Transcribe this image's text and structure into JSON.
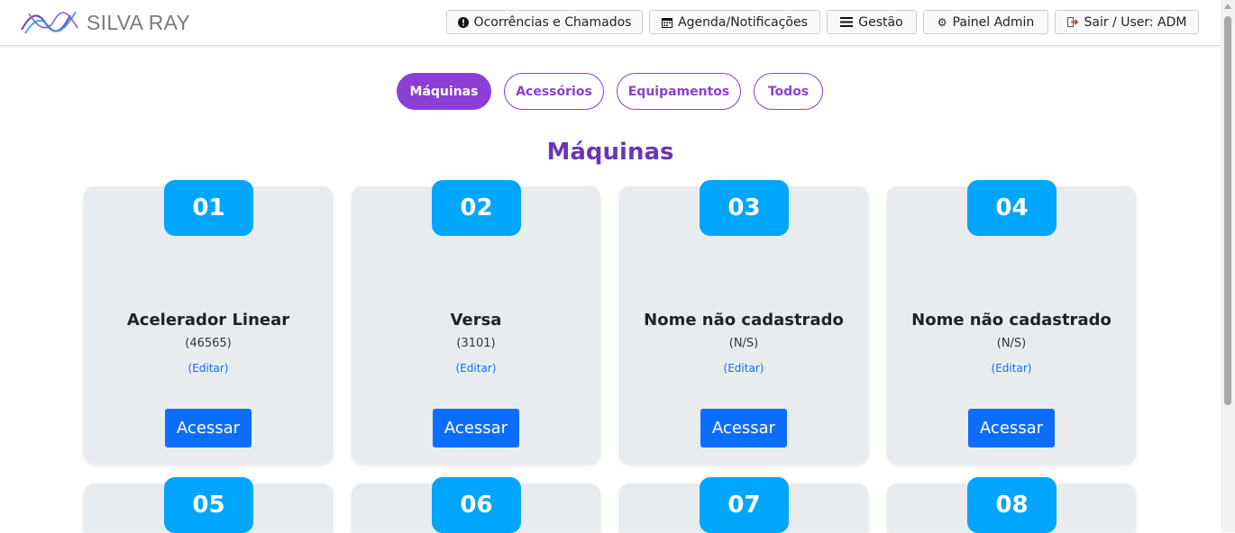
{
  "brand": {
    "name": "SILVA RAY"
  },
  "nav": [
    {
      "icon": "exclamation-circle-icon",
      "label": "Ocorrências e Chamados"
    },
    {
      "icon": "calendar-icon",
      "label": "Agenda/Notificações"
    },
    {
      "icon": "list-icon",
      "label": "Gestão"
    },
    {
      "icon": "gear-icon",
      "label": "Painel Admin"
    },
    {
      "icon": "logout-icon",
      "label": "Sair / User: ADM"
    }
  ],
  "filters": [
    {
      "label": "Máquinas",
      "active": true
    },
    {
      "label": "Acessórios",
      "active": false
    },
    {
      "label": "Equipamentos",
      "active": false
    },
    {
      "label": "Todos",
      "active": false
    }
  ],
  "section_title": "Máquinas",
  "cards": [
    {
      "number": "01",
      "name": "Acelerador Linear",
      "serial": "(46565)",
      "edit": "(Editar)",
      "action": "Acessar"
    },
    {
      "number": "02",
      "name": "Versa",
      "serial": "(3101)",
      "edit": "(Editar)",
      "action": "Acessar"
    },
    {
      "number": "03",
      "name": "Nome não cadastrado",
      "serial": "(N/S)",
      "edit": "(Editar)",
      "action": "Acessar"
    },
    {
      "number": "04",
      "name": "Nome não cadastrado",
      "serial": "(N/S)",
      "edit": "(Editar)",
      "action": "Acessar"
    },
    {
      "number": "05"
    },
    {
      "number": "06"
    },
    {
      "number": "07"
    },
    {
      "number": "08"
    }
  ],
  "colors": {
    "accent_purple": "#8b3fd6",
    "badge_blue": "#00a6fb",
    "button_blue": "#0d6efd",
    "title_purple": "#6c35b5",
    "card_bg": "#e9ecef"
  }
}
